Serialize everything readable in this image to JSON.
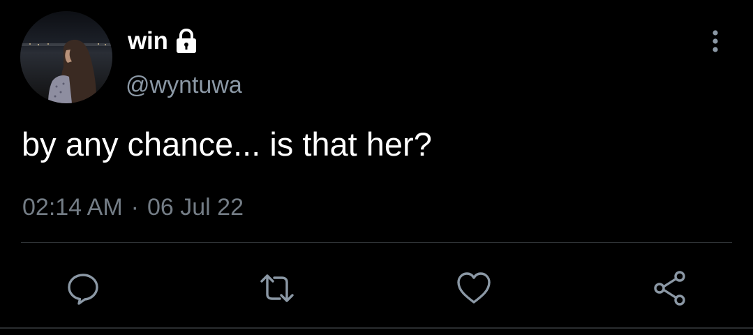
{
  "tweet": {
    "display_name": "win",
    "handle": "@wyntuwa",
    "text": "by any chance... is that her?",
    "time": "02:14 AM",
    "separator": "·",
    "date": "06 Jul 22"
  },
  "icons": {
    "lock": "lock-icon",
    "more": "more-vertical-icon",
    "reply": "reply-icon",
    "retweet": "retweet-icon",
    "like": "heart-icon",
    "share": "share-icon"
  },
  "colors": {
    "background": "#000000",
    "primary_text": "#ffffff",
    "secondary_text": "#8b98a5",
    "icon": "#8b98a5",
    "divider": "#2f3336"
  }
}
